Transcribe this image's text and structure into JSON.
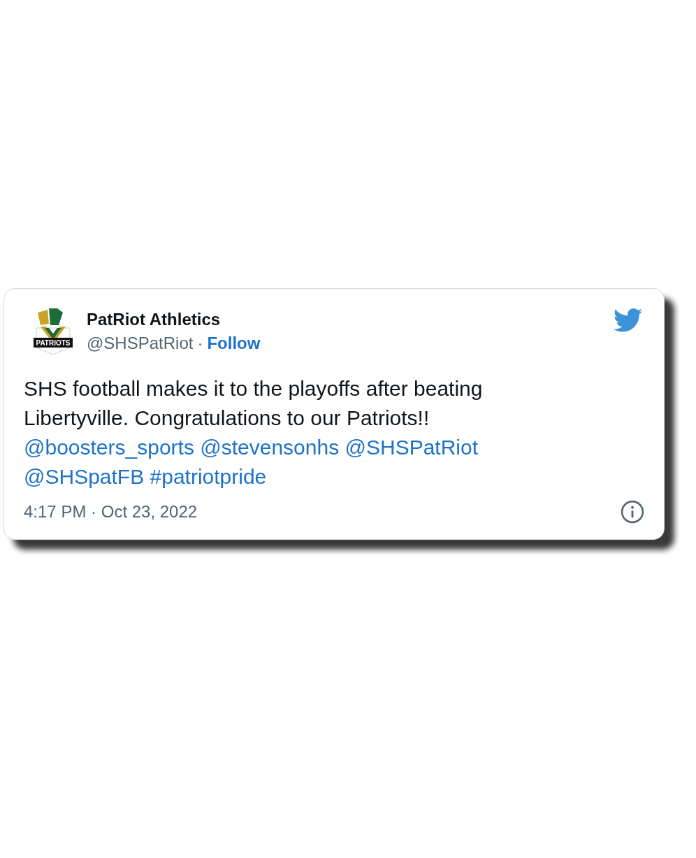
{
  "tweet": {
    "author": {
      "name": "PatRiot Athletics",
      "handle": "@SHSPatRiot",
      "separator": "·",
      "follow": "Follow",
      "logo_text": "PATRIOTS"
    },
    "body": [
      {
        "kind": "text",
        "text": "SHS football makes it to the playoffs after beating Libertyville. Congratulations to our Patriots!!"
      },
      {
        "kind": "mention",
        "text": "@boosters_sports"
      },
      {
        "kind": "mention",
        "text": "@stevensonhs"
      },
      {
        "kind": "mention",
        "text": "@SHSPatRiot"
      },
      {
        "kind": "mention",
        "text": "@SHSpatFB"
      },
      {
        "kind": "hashtag",
        "text": "#patriotpride"
      }
    ],
    "timestamp": "4:17 PM · Oct 23, 2022"
  }
}
